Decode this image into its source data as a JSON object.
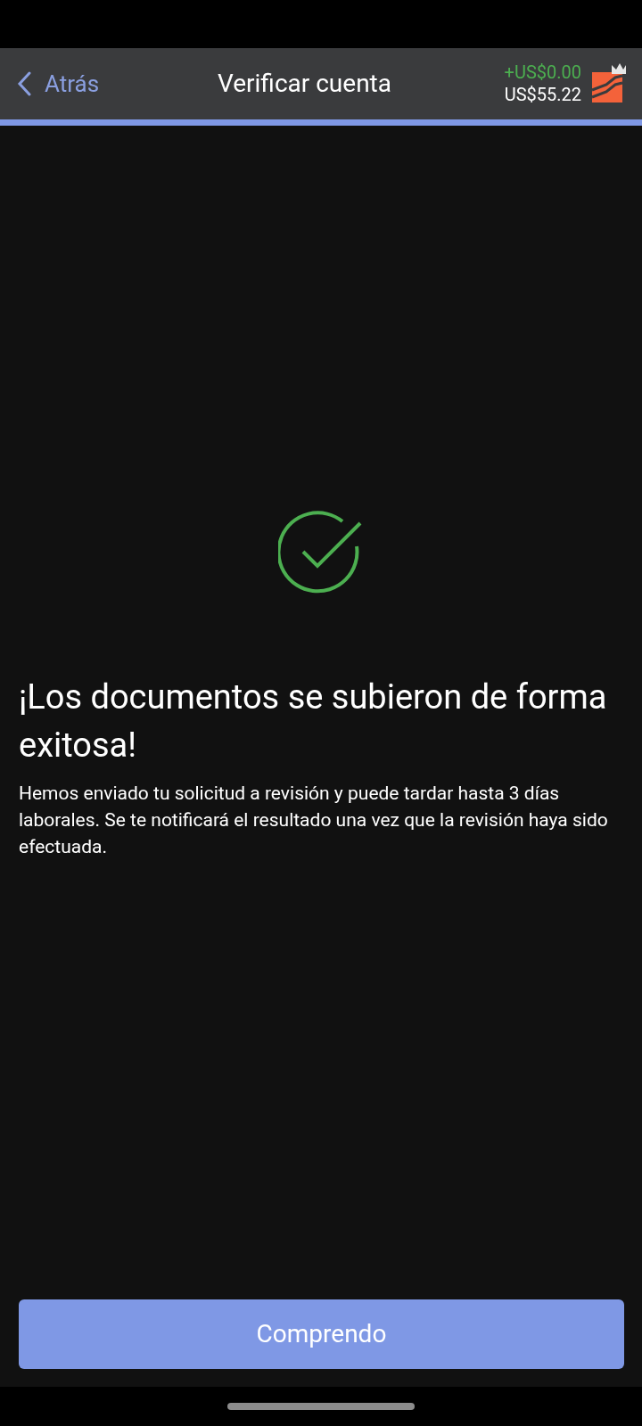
{
  "header": {
    "back_label": "Atrás",
    "title": "Verificar cuenta",
    "balance_change": "+US$0.00",
    "balance": "US$55.22"
  },
  "message": {
    "heading": "¡Los documentos se subieron de forma exitosa!",
    "body": "Hemos enviado tu solicitud a revisión y puede tardar hasta 3 días laborales. Se te notificará el resultado una vez que la revisión haya sido efectuada."
  },
  "button": {
    "label": "Comprendo"
  }
}
